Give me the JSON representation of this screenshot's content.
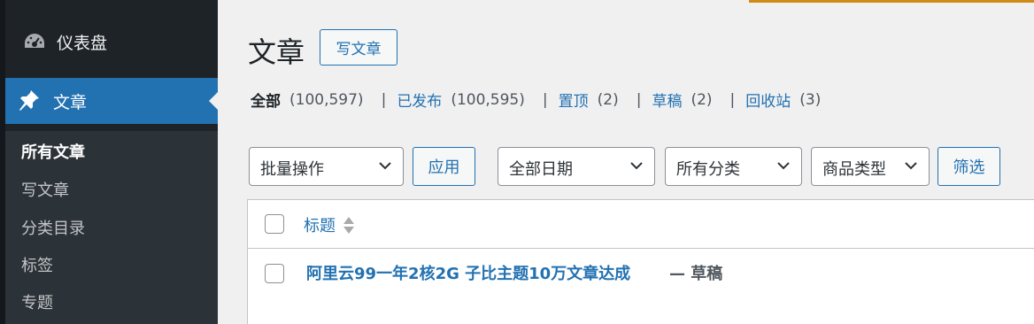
{
  "sidebar": {
    "dashboard_label": "仪表盘",
    "posts_label": "文章",
    "submenu": [
      {
        "label": "所有文章",
        "current": true
      },
      {
        "label": "写文章",
        "current": false
      },
      {
        "label": "分类目录",
        "current": false
      },
      {
        "label": "标签",
        "current": false
      },
      {
        "label": "专题",
        "current": false
      }
    ],
    "icons": {
      "dashboard": "dashboard-gauge-icon",
      "posts": "pushpin-icon"
    }
  },
  "header": {
    "title": "文章",
    "add_new_label": "写文章"
  },
  "views": [
    {
      "label": "全部",
      "count": "(100,597)",
      "current": true
    },
    {
      "label": "已发布",
      "count": "(100,595)",
      "current": false
    },
    {
      "label": "置顶",
      "count": "(2)",
      "current": false
    },
    {
      "label": "草稿",
      "count": "(2)",
      "current": false
    },
    {
      "label": "回收站",
      "count": "(3)",
      "current": false
    }
  ],
  "filters": {
    "bulk_action": "批量操作",
    "apply_label": "应用",
    "date": "全部日期",
    "category": "所有分类",
    "product_type": "商品类型",
    "filter_label": "筛选"
  },
  "table": {
    "column_title": "标题",
    "rows": [
      {
        "title": "阿里云99一年2核2G 子比主题10万文章达成",
        "state": "— 草稿"
      }
    ]
  },
  "colors": {
    "sidebar_bg": "#1d2327",
    "accent": "#2271b1",
    "page_bg": "#f0f0f1",
    "top_progress": "#d08a16"
  }
}
